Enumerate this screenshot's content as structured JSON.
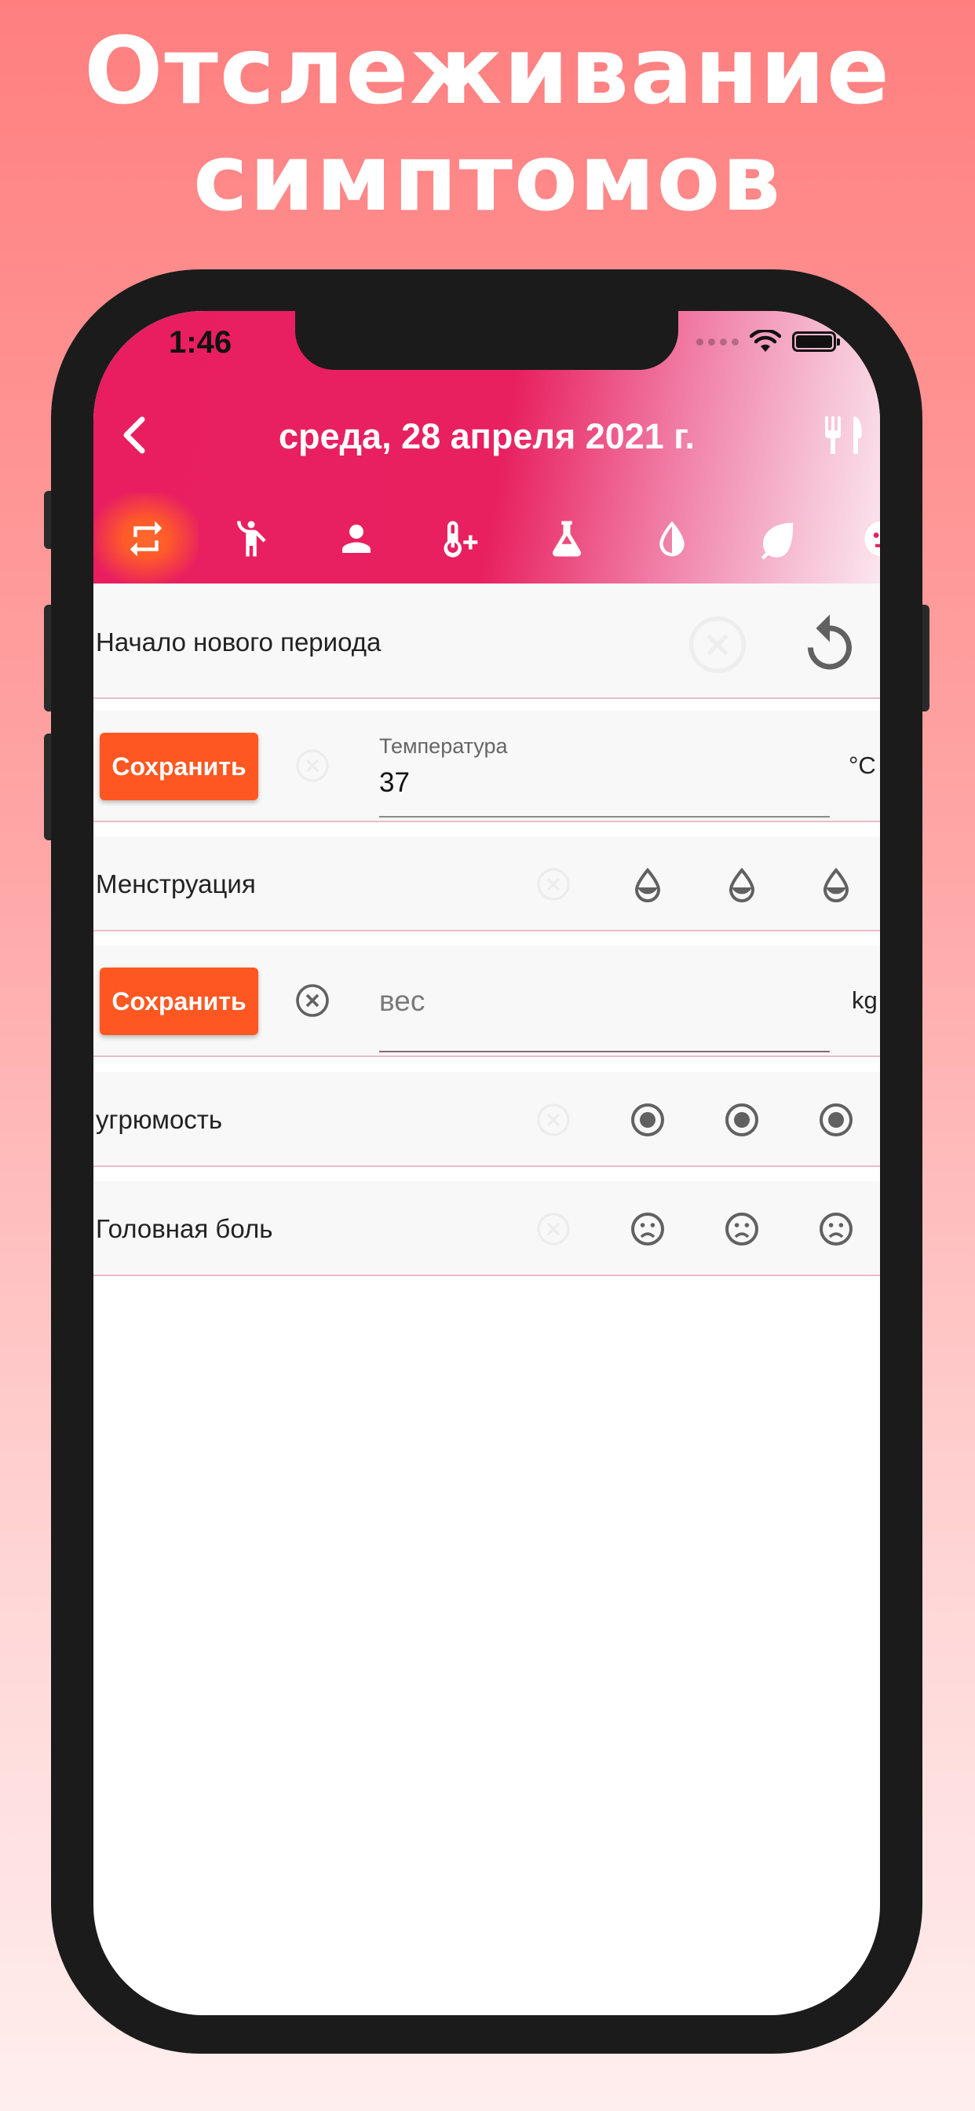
{
  "promo": {
    "title_line1": "Отслеживание",
    "title_line2": "симптомов"
  },
  "status_bar": {
    "time": "1:46"
  },
  "app_bar": {
    "title": "среда, 28 апреля 2021 г."
  },
  "tabs": [
    {
      "icon": "swap-arrows-icon",
      "active": true
    },
    {
      "icon": "exercise-figure-icon"
    },
    {
      "icon": "person-icon"
    },
    {
      "icon": "thermometer-plus-icon"
    },
    {
      "icon": "flask-icon"
    },
    {
      "icon": "drop-half-icon"
    },
    {
      "icon": "leaf-icon"
    },
    {
      "icon": "face-icon"
    }
  ],
  "rows": {
    "new_period": {
      "label": "Начало нового периода"
    },
    "temperature": {
      "save_label": "Сохранить",
      "field_label": "Температура",
      "value": "37",
      "unit": "°C"
    },
    "menstruation": {
      "label": "Менструация"
    },
    "weight": {
      "save_label": "Сохранить",
      "placeholder": "вес",
      "unit": "kg"
    },
    "gloom": {
      "label": "угрюмость"
    },
    "headache": {
      "label": "Головная боль"
    }
  },
  "colors": {
    "accent": "#ff5722",
    "header_pink": "#e81e61",
    "row_bg": "#f8f8f8",
    "divider": "#e9bcc8"
  }
}
